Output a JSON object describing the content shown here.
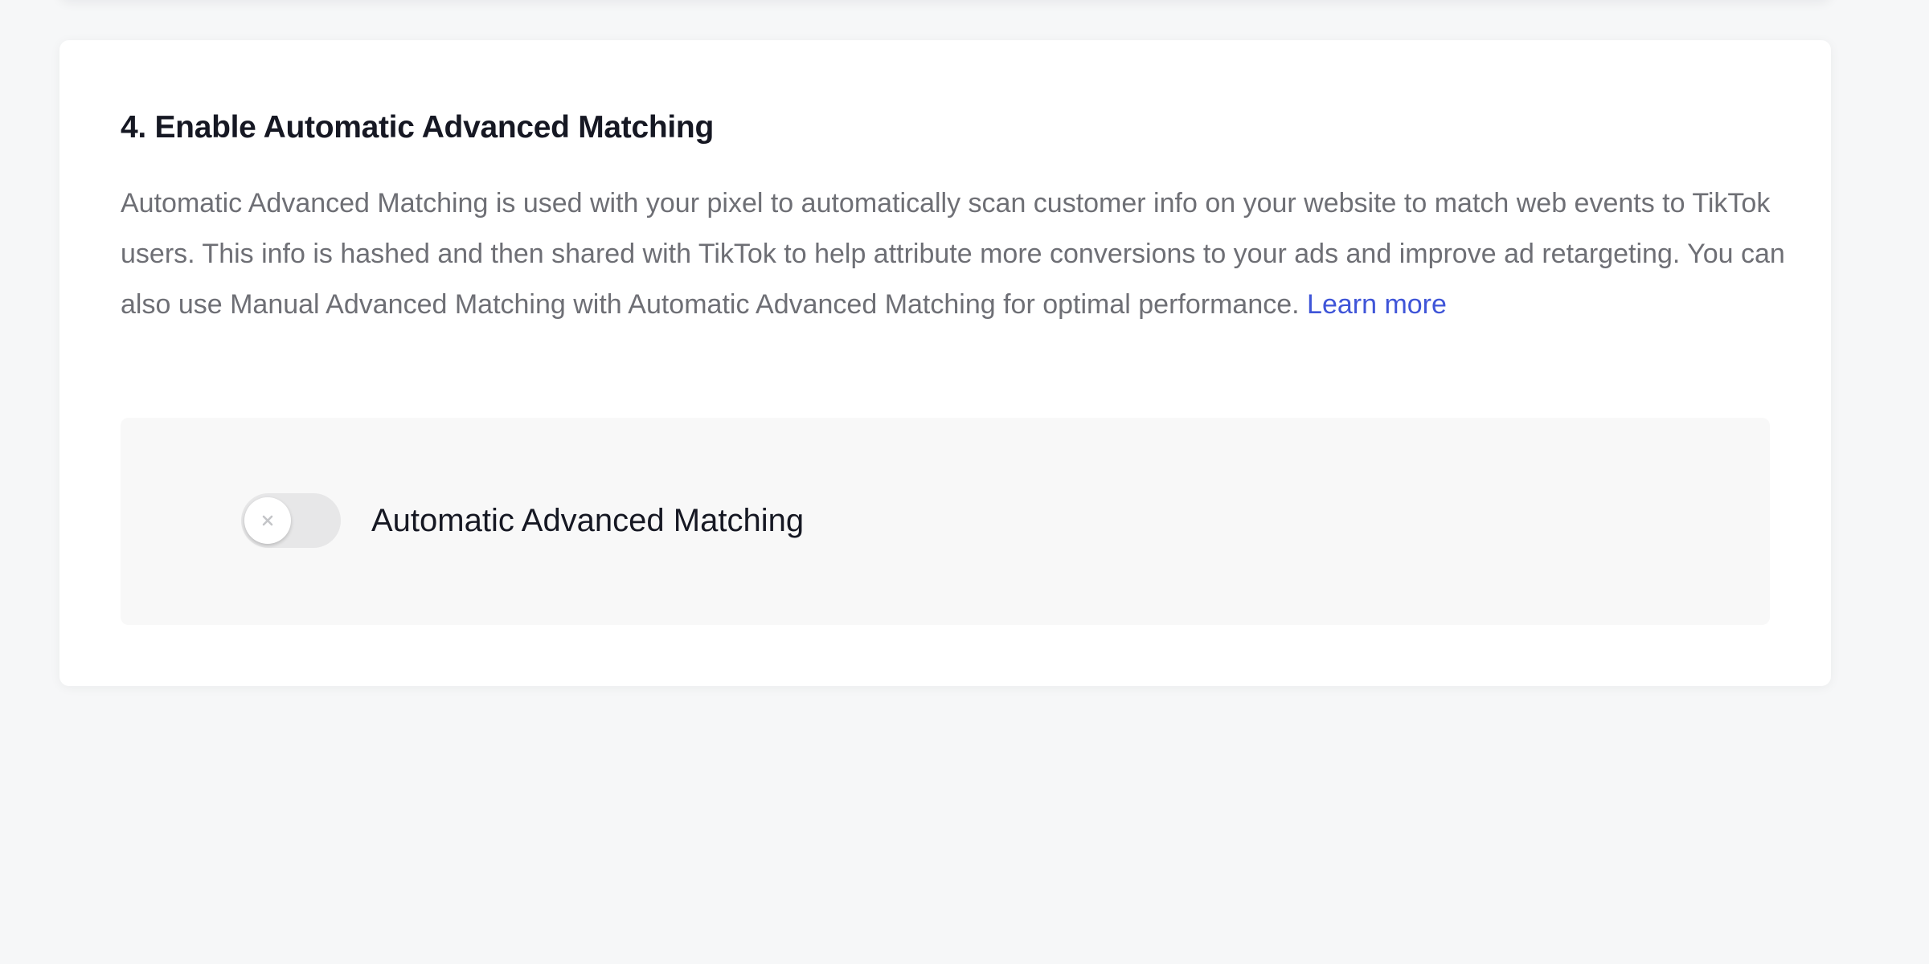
{
  "section": {
    "title": "4. Enable Automatic Advanced Matching",
    "description": "Automatic Advanced Matching is used with your pixel to automatically scan customer info on your website to match web events to TikTok users. This info is hashed and then shared with TikTok to help attribute more conversions to your ads and improve ad retargeting. You can also use Manual Advanced Matching with Automatic Advanced Matching for optimal performance.",
    "learn_more_label": "Learn more"
  },
  "toggle": {
    "label": "Automatic Advanced Matching",
    "enabled": false,
    "knob_icon": "close-icon"
  },
  "colors": {
    "link": "#3f55d8",
    "toggle_off_track": "#e7e7e8",
    "title_text": "#161823",
    "body_text": "#6e6f75"
  }
}
